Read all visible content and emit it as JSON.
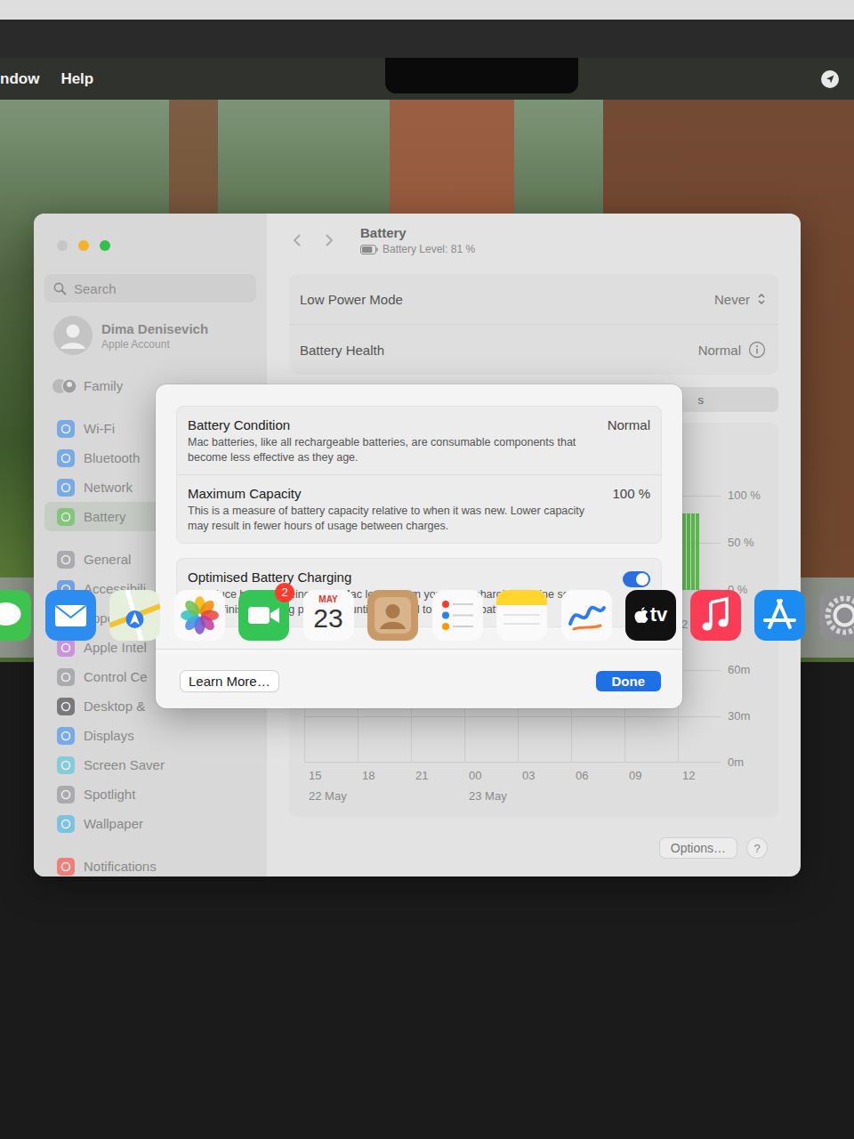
{
  "menu_bar": {
    "items": [
      "ndow",
      "Help"
    ]
  },
  "window": {
    "title": "Battery",
    "subtitle": "Battery Level: 81 %",
    "battery_level": 0.81,
    "search": {
      "placeholder": "Search"
    },
    "account": {
      "name": "Dima Denisevich",
      "subtitle": "Apple Account"
    },
    "sidebar": {
      "groups": [
        [
          {
            "label": "Family",
            "kind": "family",
            "selected": false
          }
        ],
        [
          {
            "label": "Wi-Fi",
            "kind": "pane",
            "color": "#3a8ef0",
            "selected": false
          },
          {
            "label": "Bluetooth",
            "kind": "pane",
            "color": "#3a8ef0",
            "selected": false
          },
          {
            "label": "Network",
            "kind": "pane",
            "color": "#3a8ef0",
            "selected": false
          },
          {
            "label": "Battery",
            "kind": "pane",
            "color": "#56c14a",
            "selected": true
          }
        ],
        [
          {
            "label": "General",
            "kind": "pane",
            "color": "#8e8e93",
            "selected": false
          },
          {
            "label": "Accessibili",
            "kind": "pane",
            "color": "#2f7bf0",
            "selected": false
          },
          {
            "label": "Appearanc",
            "kind": "pane",
            "color": "#1c1c1e",
            "selected": false
          },
          {
            "label": "Apple Intel",
            "kind": "pane",
            "color": "#c06ad8",
            "selected": false
          },
          {
            "label": "Control Ce",
            "kind": "pane",
            "color": "#8e8e93",
            "selected": false
          },
          {
            "label": "Desktop &",
            "kind": "pane",
            "color": "#3b3b3f",
            "selected": false
          },
          {
            "label": "Displays",
            "kind": "pane",
            "color": "#3a8ef0",
            "selected": false
          },
          {
            "label": "Screen Saver",
            "kind": "pane",
            "color": "#4fc3d9",
            "selected": false
          },
          {
            "label": "Spotlight",
            "kind": "pane",
            "color": "#8e8e93",
            "selected": false
          },
          {
            "label": "Wallpaper",
            "kind": "pane",
            "color": "#3fb6e8",
            "selected": false
          }
        ],
        [
          {
            "label": "Notifications",
            "kind": "pane",
            "color": "#ff453a",
            "selected": false
          }
        ]
      ]
    },
    "rows": [
      {
        "label": "Low Power Mode",
        "value": "Never",
        "kind": "popup"
      },
      {
        "label": "Battery Health",
        "value": "Normal",
        "kind": "info"
      }
    ],
    "segment_fragment": "s",
    "level_chart": {
      "ticks": [
        "100 %",
        "50 %",
        "0 %"
      ],
      "x_fragment": "2",
      "series": [
        0,
        0,
        0,
        0,
        0,
        0,
        0,
        0,
        0,
        0,
        0,
        0,
        0,
        0,
        0,
        0,
        0,
        0,
        0,
        0,
        0,
        0,
        0,
        0,
        0,
        0,
        0,
        0,
        0,
        0,
        0,
        0,
        0,
        0,
        0,
        0,
        0,
        0,
        0,
        0,
        0,
        0,
        0,
        0,
        0,
        0,
        0,
        0,
        0,
        0,
        0,
        0,
        0,
        0,
        0,
        0,
        0,
        0,
        0,
        0,
        0,
        0,
        0,
        0,
        0,
        0,
        0,
        0,
        0,
        0,
        0,
        0,
        0,
        0,
        0,
        0,
        0,
        0,
        0,
        0,
        0,
        0,
        0,
        0,
        81,
        81,
        81,
        81,
        81,
        0,
        0,
        0
      ]
    },
    "usage_chart": {
      "ticks": [
        "60m",
        "30m",
        "0m"
      ],
      "x_labels": [
        {
          "label": "15",
          "date": "22 May"
        },
        {
          "label": "18"
        },
        {
          "label": "21"
        },
        {
          "label": "00",
          "date": "23 May"
        },
        {
          "label": "03"
        },
        {
          "label": "06"
        },
        {
          "label": "09"
        },
        {
          "label": "12"
        }
      ]
    },
    "options_button": "Options…",
    "help_button": "?"
  },
  "dialog": {
    "rows": [
      {
        "title": "Battery Condition",
        "value": "Normal",
        "description": "Mac batteries, like all rechargeable batteries, are consumable components that become less effective as they age."
      },
      {
        "title": "Maximum Capacity",
        "value": "100 %",
        "description": "This is a measure of battery capacity relative to when it was new. Lower capacity may result in fewer hours of usage between charges."
      }
    ],
    "toggle": {
      "title": "Optimised Battery Charging",
      "on": true,
      "description": "To reduce battery ageing, your Mac learns from your daily charging routine so it can wait to finish charging past 80 % until you need to use it on battery."
    },
    "buttons": {
      "secondary": "Learn More…",
      "primary": "Done"
    }
  },
  "dock": [
    {
      "kind": "messages",
      "running": false
    },
    {
      "kind": "mail",
      "running": false
    },
    {
      "kind": "maps",
      "running": false
    },
    {
      "kind": "photos",
      "running": false
    },
    {
      "kind": "facetime",
      "running": false,
      "badge": "2"
    },
    {
      "kind": "calendar",
      "running": false,
      "month": "MAY",
      "day": "23"
    },
    {
      "kind": "contacts",
      "running": false
    },
    {
      "kind": "reminders",
      "running": false
    },
    {
      "kind": "notes",
      "running": true
    },
    {
      "kind": "freeform",
      "running": false
    },
    {
      "kind": "tv",
      "running": false,
      "label": "tv"
    },
    {
      "kind": "music",
      "running": true
    },
    {
      "kind": "appstore",
      "running": false
    },
    {
      "kind": "settings",
      "running": false
    }
  ]
}
